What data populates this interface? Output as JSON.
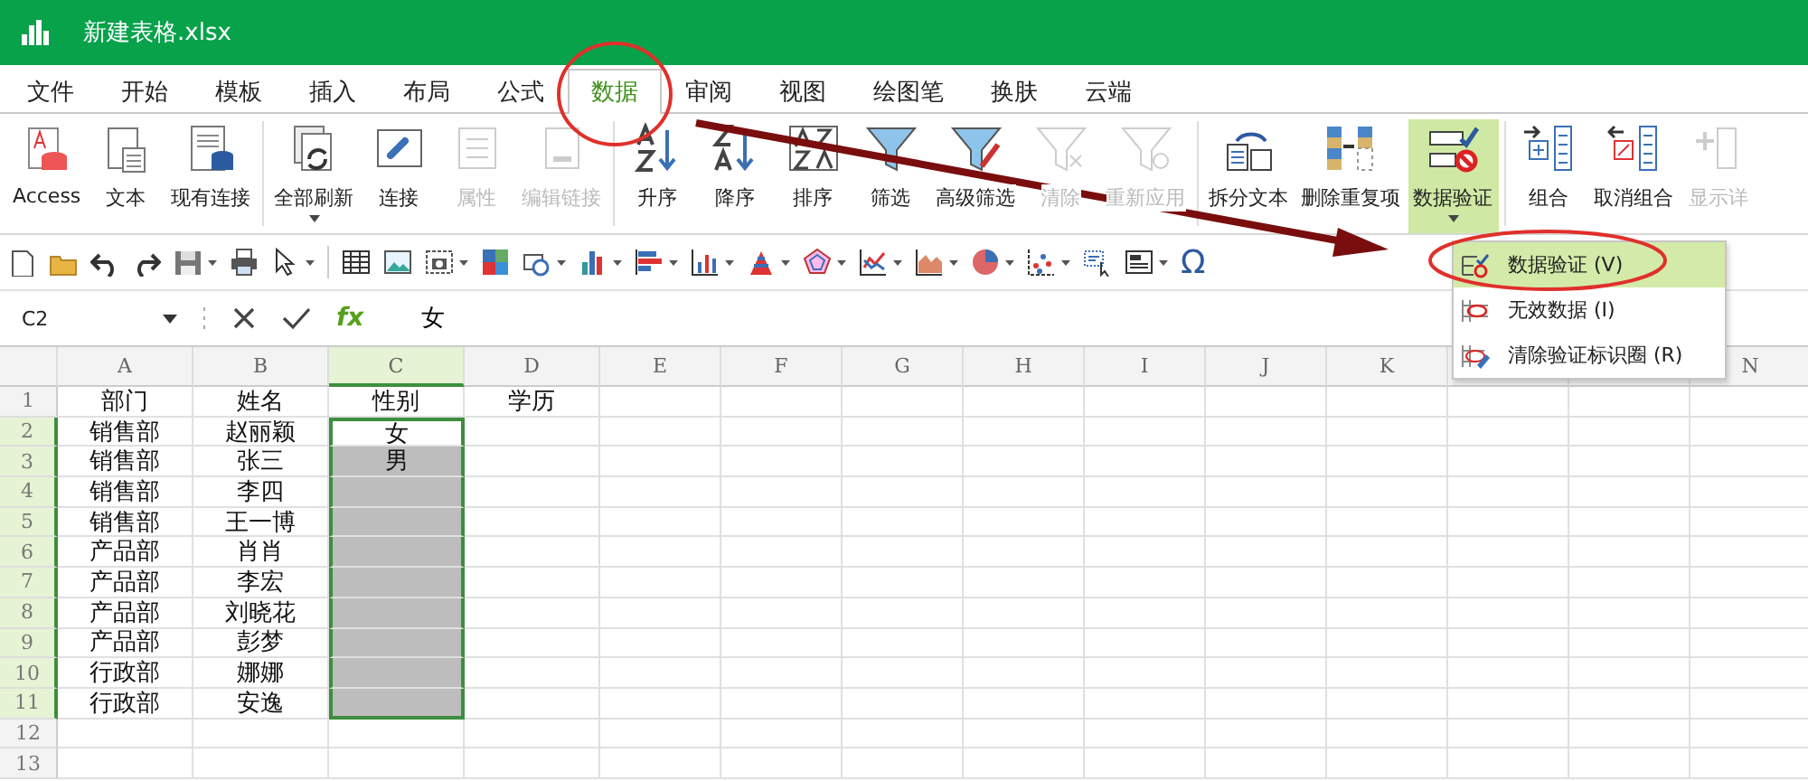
{
  "window": {
    "title": "新建表格.xlsx"
  },
  "tabs": [
    {
      "label": "文件",
      "selected": false
    },
    {
      "label": "开始",
      "selected": false
    },
    {
      "label": "模板",
      "selected": false
    },
    {
      "label": "插入",
      "selected": false
    },
    {
      "label": "布局",
      "selected": false
    },
    {
      "label": "公式",
      "selected": false
    },
    {
      "label": "数据",
      "selected": true
    },
    {
      "label": "审阅",
      "selected": false
    },
    {
      "label": "视图",
      "selected": false
    },
    {
      "label": "绘图笔",
      "selected": false
    },
    {
      "label": "换肤",
      "selected": false
    },
    {
      "label": "云端",
      "selected": false
    }
  ],
  "ribbon": {
    "groups": [
      [
        {
          "label": "Access",
          "disabled": false,
          "selected": false,
          "dropdown": false
        },
        {
          "label": "文本",
          "disabled": false,
          "selected": false,
          "dropdown": false
        },
        {
          "label": "现有连接",
          "disabled": false,
          "selected": false,
          "dropdown": false
        }
      ],
      [
        {
          "label": "全部刷新",
          "disabled": false,
          "selected": false,
          "dropdown": true
        },
        {
          "label": "连接",
          "disabled": false,
          "selected": false,
          "dropdown": false
        },
        {
          "label": "属性",
          "disabled": true,
          "selected": false,
          "dropdown": false
        },
        {
          "label": "编辑链接",
          "disabled": true,
          "selected": false,
          "dropdown": false
        }
      ],
      [
        {
          "label": "升序",
          "disabled": false,
          "selected": false,
          "dropdown": false
        },
        {
          "label": "降序",
          "disabled": false,
          "selected": false,
          "dropdown": false
        },
        {
          "label": "排序",
          "disabled": false,
          "selected": false,
          "dropdown": false
        },
        {
          "label": "筛选",
          "disabled": false,
          "selected": false,
          "dropdown": false
        },
        {
          "label": "高级筛选",
          "disabled": false,
          "selected": false,
          "dropdown": false
        },
        {
          "label": "清除",
          "disabled": true,
          "selected": false,
          "dropdown": false
        },
        {
          "label": "重新应用",
          "disabled": true,
          "selected": false,
          "dropdown": false
        }
      ],
      [
        {
          "label": "拆分文本",
          "disabled": false,
          "selected": false,
          "dropdown": false
        },
        {
          "label": "删除重复项",
          "disabled": false,
          "selected": false,
          "dropdown": false
        },
        {
          "label": "数据验证",
          "disabled": false,
          "selected": true,
          "dropdown": true
        }
      ],
      [
        {
          "label": "组合",
          "disabled": false,
          "selected": false,
          "dropdown": false
        },
        {
          "label": "取消组合",
          "disabled": false,
          "selected": false,
          "dropdown": false
        },
        {
          "label": "显示详",
          "disabled": true,
          "selected": false,
          "dropdown": false
        }
      ]
    ]
  },
  "toolbar": {
    "symbol": "Ω"
  },
  "formula_bar": {
    "name_box": "C2",
    "fx": "fx",
    "value": "女"
  },
  "sheet": {
    "columns": [
      {
        "label": "A",
        "selected": false
      },
      {
        "label": "B",
        "selected": false
      },
      {
        "label": "C",
        "selected": true
      },
      {
        "label": "D",
        "selected": false
      },
      {
        "label": "E",
        "selected": false
      },
      {
        "label": "F",
        "selected": false
      },
      {
        "label": "G",
        "selected": false
      },
      {
        "label": "H",
        "selected": false
      },
      {
        "label": "I",
        "selected": false
      },
      {
        "label": "J",
        "selected": false
      },
      {
        "label": "K",
        "selected": false
      },
      {},
      {},
      {
        "label": "N",
        "selected": false
      }
    ],
    "rows": [
      {
        "header": "1",
        "selected": false,
        "cells": [
          "部门",
          "姓名",
          "性别",
          "学历"
        ]
      },
      {
        "header": "2",
        "selected": true,
        "cells": [
          "销售部",
          "赵丽颖",
          "女"
        ]
      },
      {
        "header": "3",
        "selected": true,
        "cells": [
          "销售部",
          "张三",
          "男"
        ]
      },
      {
        "header": "4",
        "selected": true,
        "cells": [
          "销售部",
          "李四"
        ]
      },
      {
        "header": "5",
        "selected": true,
        "cells": [
          "销售部",
          "王一博"
        ]
      },
      {
        "header": "6",
        "selected": true,
        "cells": [
          "产品部",
          "肖肖"
        ]
      },
      {
        "header": "7",
        "selected": true,
        "cells": [
          "产品部",
          "李宏"
        ]
      },
      {
        "header": "8",
        "selected": true,
        "cells": [
          "产品部",
          "刘晓花"
        ]
      },
      {
        "header": "9",
        "selected": true,
        "cells": [
          "产品部",
          "彭梦"
        ]
      },
      {
        "header": "10",
        "selected": true,
        "cells": [
          "行政部",
          "娜娜"
        ]
      },
      {
        "header": "11",
        "selected": true,
        "cells": [
          "行政部",
          "安逸"
        ]
      },
      {
        "header": "12",
        "selected": false,
        "cells": []
      },
      {
        "header": "13",
        "selected": false,
        "cells": []
      }
    ]
  },
  "menu": {
    "items": [
      {
        "label": "数据验证 (V)",
        "selected": true
      },
      {
        "label": "无效数据 (I)",
        "selected": false
      },
      {
        "label": "清除验证标识圈 (R)",
        "selected": false
      }
    ]
  }
}
